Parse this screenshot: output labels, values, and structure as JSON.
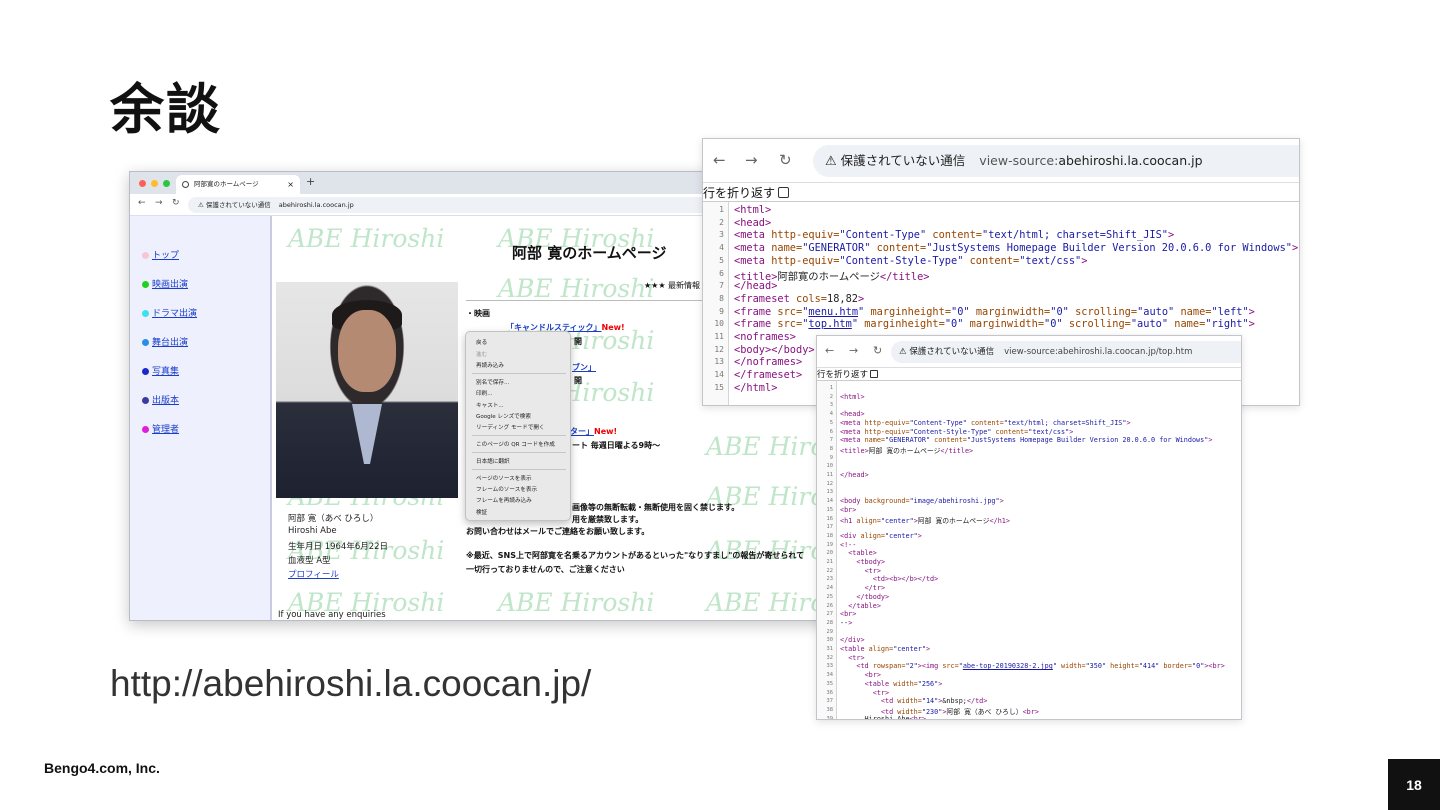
{
  "slide": {
    "title": "余談",
    "url_caption": "http://abehiroshi.la.coocan.jp/",
    "company": "Bengo4.com, Inc.",
    "page_number": "18"
  },
  "browser_home": {
    "tab_title": "阿部寛のホームページ",
    "tab_close": "×",
    "new_tab": "+",
    "security_label": "保護されていない通信",
    "url": "abehiroshi.la.coocan.jp",
    "traffic_colors": [
      "#ff5f57",
      "#febc2e",
      "#28c840"
    ],
    "sidebar": [
      {
        "label": "トップ",
        "color": "#f7c6d6"
      },
      {
        "label": "映画出演",
        "color": "#20d020"
      },
      {
        "label": "ドラマ出演",
        "color": "#3ee0f0"
      },
      {
        "label": "舞台出演",
        "color": "#2a8ee8"
      },
      {
        "label": "写真集",
        "color": "#1c28c8"
      },
      {
        "label": "出版本",
        "color": "#3a3aa0"
      },
      {
        "label": "管理者",
        "color": "#e020d8"
      }
    ],
    "watermark": "ABE Hiroshi",
    "page_title": "阿部 寛のホームページ",
    "stars_line": "★★★ 最新情報",
    "section_movie": "・映画",
    "movie_item": "「キャンドルスティック」",
    "new_badge": "New!",
    "item_kai1": "開",
    "item_bun": "ブン」",
    "item_kai2": "開",
    "item_ta": "ター」",
    "new_badge2": "New!",
    "item_weekly": "ート 毎週日曜よる9時～",
    "notice1": "画像等の無断転載・無断使用を固く禁じます。",
    "notice2": "用を厳禁致します。",
    "notice3": "お問い合わせはメールでご連絡をお願い致します。",
    "notice4": "※最近、SNS上で阿部寛を名乗るアカウントがあるといった\"なりすまし\"の報告が寄せられて",
    "notice5": "一切行っておりませんので、ご注意ください",
    "profile": {
      "name_jp": "阿部 寛（あべ ひろし）",
      "name_en": "Hiroshi Abe",
      "birthday": "生年月日 1964年6月22日",
      "blood": "血液型 A型",
      "link": "プロフィール"
    },
    "enquiries": "If you have any enquiries",
    "context_menu": [
      "戻る",
      "進む",
      "再読み込み",
      "別名で保存...",
      "印刷...",
      "キャスト...",
      "Google レンズで検索",
      "リーディング モードで開く",
      "このページの QR コードを作成",
      "日本語に翻訳",
      "ページのソースを表示",
      "フレームのソースを表示",
      "フレームを再読み込み",
      "検証"
    ]
  },
  "source_window_1": {
    "security_label": "保護されていない通信",
    "url_prefix": "view-source:",
    "url_host": "abehiroshi.la.coocan.jp",
    "wrap_label": "行を折り返す",
    "lines": [
      "<html>",
      "<head>",
      "<meta http-equiv=\"Content-Type\" content=\"text/html; charset=Shift_JIS\">",
      "<meta name=\"GENERATOR\" content=\"JustSystems Homepage Builder Version 20.0.6.0 for Windows\">",
      "<meta http-equiv=\"Content-Style-Type\" content=\"text/css\">",
      "<title>阿部寛のホームページ</title>",
      "</head>",
      "<frameset cols=18,82>",
      "  <frame src=\"menu.htm\" marginheight=\"0\" marginwidth=\"0\" scrolling=\"auto\" name=\"left\">",
      "  <frame src=\"top.htm\" marginheight=\"0\" marginwidth=\"0\" scrolling=\"auto\" name=\"right\">",
      "  <noframes>",
      "  <body></body>",
      "  </noframes>",
      "</frameset>",
      "</html>"
    ]
  },
  "source_window_2": {
    "security_label": "保護されていない通信",
    "url": "view-source:abehiroshi.la.coocan.jp/top.htm",
    "wrap_label": "行を折り返す",
    "lines": [
      "",
      "<html>",
      "",
      "<head>",
      "<meta http-equiv=\"Content-Type\" content=\"text/html; charset=Shift_JIS\">",
      "<meta http-equiv=\"Content-Style-Type\" content=\"text/css\">",
      "<meta name=\"GENERATOR\" content=\"JustSystems Homepage Builder Version 20.0.6.0 for Windows\">",
      "<title>阿部 寛のホームページ</title>",
      "",
      "",
      "</head>",
      "",
      "",
      "<body background=\"image/abehiroshi.jpg\">",
      "<br>",
      "<h1 align=\"center\">阿部 寛のホームページ</h1>",
      "",
      "<div align=\"center\">",
      "<!--",
      "  <table>",
      "    <tbody>",
      "      <tr>",
      "        <td><b></b></td>",
      "      </tr>",
      "    </tbody>",
      "  </table>",
      "<br>",
      "-->",
      "",
      "</div>",
      "<table align=\"center\">",
      "  <tr>",
      "    <td rowspan=\"2\"><img src=\"abe-top-20190328-2.jpg\" width=\"350\" height=\"414\" border=\"0\"><br>",
      "      <br>",
      "      <table width=\"256\">",
      "        <tr>",
      "          <td width=\"14\">&nbsp;</td>",
      "          <td width=\"230\">阿部 寛（あべ ひろし）<br>",
      "      Hiroshi Abe<br>"
    ]
  }
}
